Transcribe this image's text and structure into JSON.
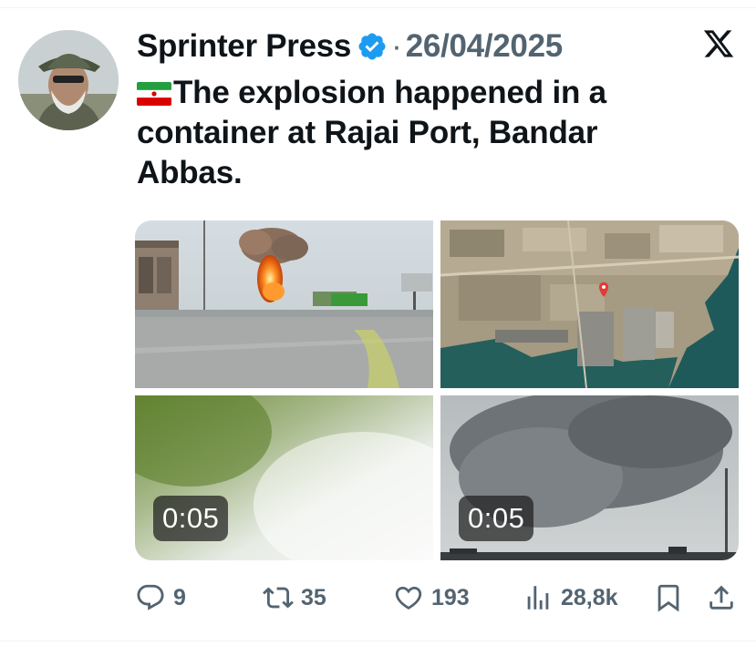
{
  "post": {
    "author_name": "Sprinter Press",
    "separator": "·",
    "date": "26/04/2025",
    "text": "The explosion happened in a container at Rajai Port, Bandar Abbas.",
    "flag_emoji": "iran-flag-icon"
  },
  "media": {
    "videos": [
      {
        "duration": "0:05"
      },
      {
        "duration": "0:05"
      }
    ]
  },
  "actions": {
    "replies": "9",
    "reposts": "35",
    "likes": "193",
    "views": "28,8k"
  },
  "colors": {
    "text": "#0f1419",
    "muted": "#536471",
    "verified": "#1d9bf0",
    "divider": "#eff3f4"
  }
}
